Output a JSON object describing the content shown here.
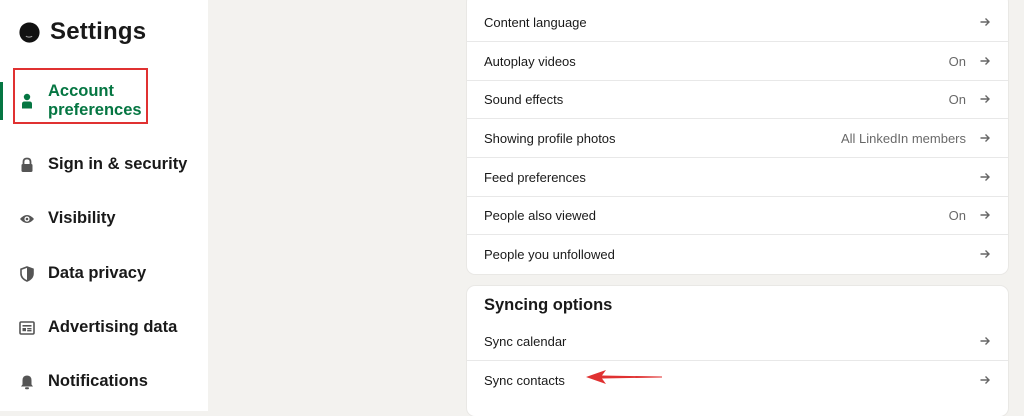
{
  "app": {
    "title": "Settings",
    "accent_color": "#057642",
    "annotation_color": "#e03131"
  },
  "sidebar": {
    "items": [
      {
        "label": "Account preferences",
        "icon": "person-icon",
        "active": true
      },
      {
        "label": "Sign in & security",
        "icon": "lock-icon",
        "active": false
      },
      {
        "label": "Visibility",
        "icon": "eye-icon",
        "active": false
      },
      {
        "label": "Data privacy",
        "icon": "shield-icon",
        "active": false
      },
      {
        "label": "Advertising data",
        "icon": "newspaper-icon",
        "active": false
      },
      {
        "label": "Notifications",
        "icon": "bell-icon",
        "active": false
      }
    ]
  },
  "general_card": {
    "rows": [
      {
        "label": "Content language",
        "value": ""
      },
      {
        "label": "Autoplay videos",
        "value": "On"
      },
      {
        "label": "Sound effects",
        "value": "On"
      },
      {
        "label": "Showing profile photos",
        "value": "All LinkedIn members"
      },
      {
        "label": "Feed preferences",
        "value": ""
      },
      {
        "label": "People also viewed",
        "value": "On"
      },
      {
        "label": "People you unfollowed",
        "value": ""
      }
    ]
  },
  "syncing_card": {
    "title": "Syncing options",
    "rows": [
      {
        "label": "Sync calendar",
        "value": ""
      },
      {
        "label": "Sync contacts",
        "value": ""
      }
    ]
  }
}
